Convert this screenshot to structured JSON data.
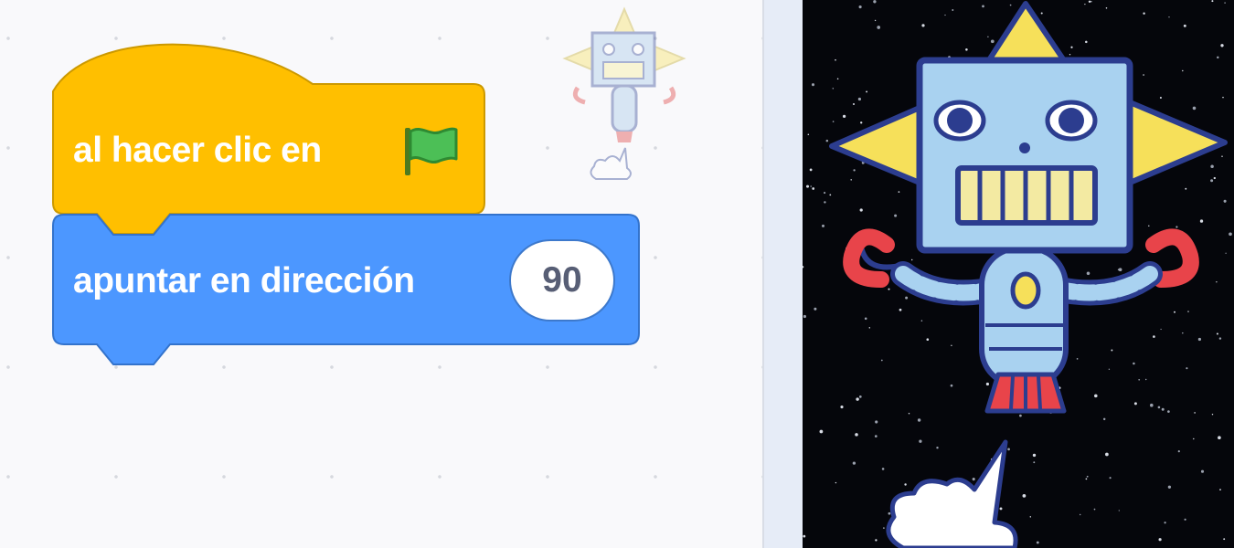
{
  "workspace": {
    "hat_block": {
      "label": "al hacer clic en",
      "icon": "green-flag-icon",
      "color": "#ffbf00"
    },
    "motion_block": {
      "label": "apuntar en dirección",
      "value": "90",
      "color": "#4c97ff"
    },
    "sprite_thumbnail": "robot-sprite-icon"
  },
  "stage": {
    "backdrop": "space-stars",
    "sprite": "robot-sprite",
    "background_color": "#05060b"
  }
}
